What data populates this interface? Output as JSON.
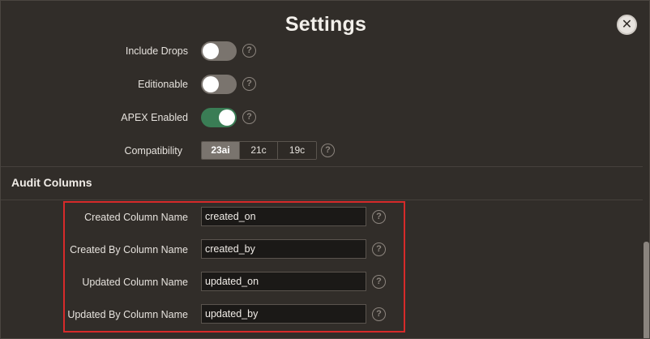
{
  "dialog": {
    "title": "Settings",
    "close_icon": "close-icon",
    "close_glyph": "✕"
  },
  "settings": {
    "include_drops": {
      "label": "Include Drops",
      "on": false
    },
    "editionable": {
      "label": "Editionable",
      "on": false
    },
    "apex_enabled": {
      "label": "APEX Enabled",
      "on": true
    },
    "compatibility": {
      "label": "Compatibility",
      "options": [
        "23ai",
        "21c",
        "19c"
      ],
      "selected": "23ai"
    }
  },
  "help_glyph": "?",
  "audit": {
    "section_title": "Audit Columns",
    "created_column": {
      "label": "Created Column Name",
      "value": "created_on"
    },
    "created_by_column": {
      "label": "Created By Column Name",
      "value": "created_by"
    },
    "updated_column": {
      "label": "Updated Column Name",
      "value": "updated_on"
    },
    "updated_by_column": {
      "label": "Updated By Column Name",
      "value": "updated_by"
    }
  },
  "colors": {
    "background": "#312d29",
    "toggle_on": "#3a7d55",
    "toggle_off": "#7a746e",
    "highlight": "#d62a2a"
  }
}
